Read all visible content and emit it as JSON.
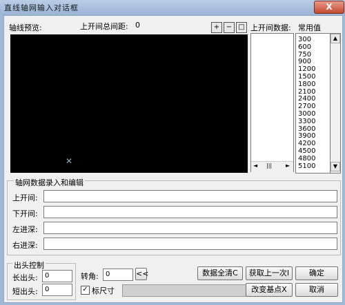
{
  "window": {
    "title": "直线轴网输入对话框",
    "close_label": "X"
  },
  "preview": {
    "label": "轴线预览:",
    "spacing_label": "上开间总间距:",
    "spacing_value": "0",
    "marker": "✕"
  },
  "zoom": {
    "in_icon": "+",
    "out_icon": "−",
    "fit_icon": "□"
  },
  "lists": {
    "data_label": "上开间数据:",
    "common_label": "常用值",
    "common_values": [
      "300",
      "600",
      "750",
      "900",
      "1200",
      "1500",
      "1800",
      "2100",
      "2400",
      "2700",
      "3000",
      "3300",
      "3600",
      "3900",
      "4200",
      "4500",
      "4800",
      "5100"
    ],
    "hscroll_thumb": "|||"
  },
  "edit_group": {
    "title": "轴网数据录入和编辑",
    "rows": [
      "上开间:",
      "下开间:",
      "左进深:",
      "右进深:"
    ]
  },
  "overhang": {
    "title": "出头控制",
    "long_label": "长出头:",
    "long_value": "0",
    "short_label": "短出头:",
    "short_value": "0"
  },
  "angle": {
    "label": "转角:",
    "value": "0",
    "button": "<<"
  },
  "dimension": {
    "label": "标尺寸",
    "checked": "✓"
  },
  "buttons": {
    "clear_all": "数据全清C",
    "fetch_last": "获取上一次I",
    "change_base": "改变基点X",
    "ok": "确定",
    "cancel": "取消"
  }
}
